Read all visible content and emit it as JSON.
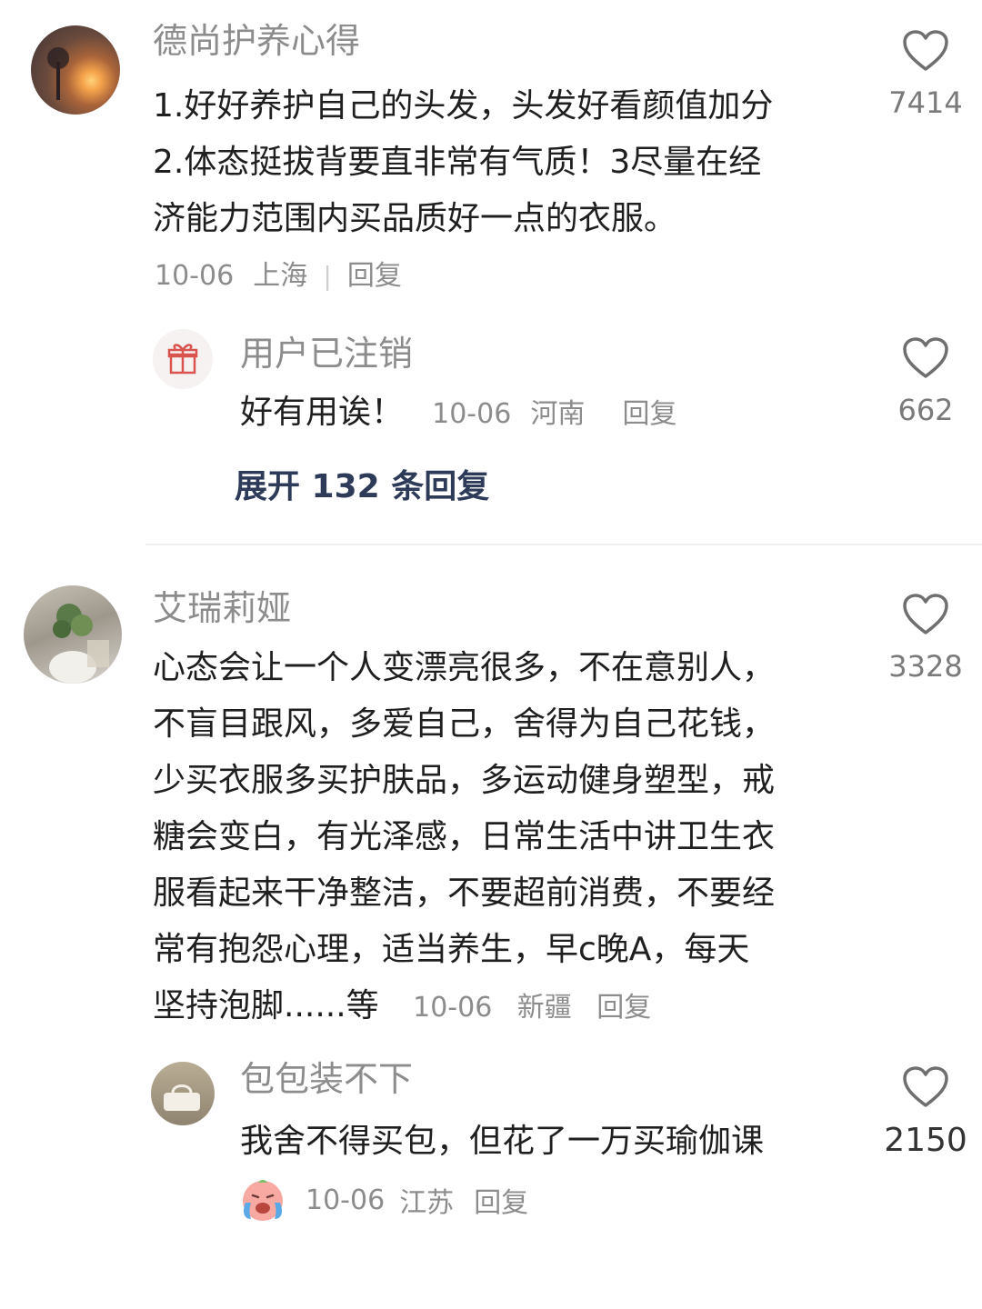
{
  "comments": [
    {
      "username": "德尚护养心得",
      "lines": [
        "1.好好养护自己的头发，头发好看颜值加分",
        "2.体态挺拔背要直非常有气质！3尽量在经",
        "济能力范围内买品质好一点的衣服。"
      ],
      "date": "10-06",
      "location": "上海",
      "reply_label": "回复",
      "likes": "7414",
      "sub_reply": {
        "username": "用户已注销",
        "text": "好有用诶！",
        "date": "10-06",
        "location": "河南",
        "reply_label": "回复",
        "likes": "662"
      },
      "expand_label": "展开 132 条回复"
    },
    {
      "username": "艾瑞莉娅",
      "lines": [
        "心态会让一个人变漂亮很多，不在意别人，",
        "不盲目跟风，多爱自己，舍得为自己花钱，",
        "少买衣服多买护肤品，多运动健身塑型，戒",
        "糖会变白，有光泽感，日常生活中讲卫生衣",
        "服看起来干净整洁，不要超前消费，不要经",
        "常有抱怨心理，适当养生，早c晚A，每天",
        "坚持泡脚......等"
      ],
      "date": "10-06",
      "location": "新疆",
      "reply_label": "回复",
      "likes": "3328",
      "sub_reply": {
        "username": "包包装不下",
        "text": "我舍不得买包，但花了一万买瑜伽课",
        "date": "10-06",
        "location": "江苏",
        "reply_label": "回复",
        "likes": "2150"
      }
    }
  ],
  "colors": {
    "muted": "#8c8c8c",
    "body": "#1f1f1f",
    "expand": "#2d3b58"
  }
}
